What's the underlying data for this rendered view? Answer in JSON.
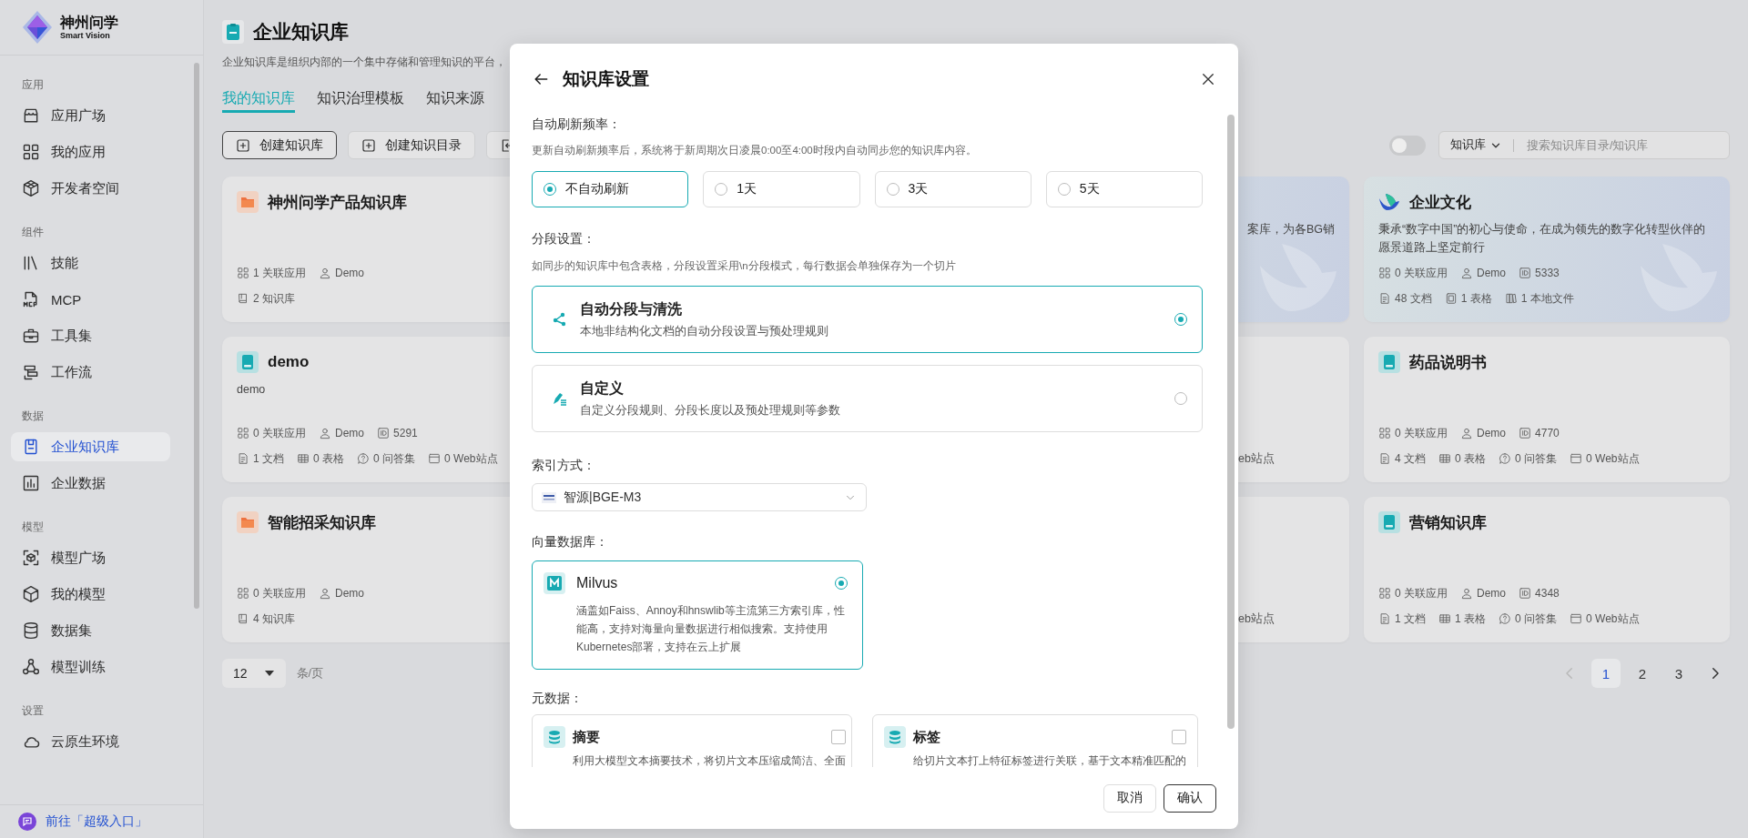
{
  "sidebar": {
    "brand": {
      "name": "神州问学",
      "tagline": "Smart Vision"
    },
    "groups": [
      {
        "label": "应用",
        "items": [
          {
            "label": "应用广场",
            "kind": "store",
            "selected": false
          },
          {
            "label": "我的应用",
            "kind": "apps",
            "selected": false
          },
          {
            "label": "开发者空间",
            "kind": "dev",
            "selected": false
          }
        ]
      },
      {
        "label": "组件",
        "items": [
          {
            "label": "技能",
            "kind": "skill",
            "selected": false
          },
          {
            "label": "MCP",
            "kind": "mcp",
            "selected": false
          },
          {
            "label": "工具集",
            "kind": "tool",
            "selected": false
          },
          {
            "label": "工作流",
            "kind": "flow",
            "selected": false
          }
        ]
      },
      {
        "label": "数据",
        "items": [
          {
            "label": "企业知识库",
            "kind": "doc",
            "selected": true
          },
          {
            "label": "企业数据",
            "kind": "chart",
            "selected": false
          }
        ]
      },
      {
        "label": "模型",
        "items": [
          {
            "label": "模型广场",
            "kind": "scan",
            "selected": false
          },
          {
            "label": "我的模型",
            "kind": "cube",
            "selected": false
          },
          {
            "label": "数据集",
            "kind": "db",
            "selected": false
          },
          {
            "label": "模型训练",
            "kind": "train",
            "selected": false
          }
        ]
      },
      {
        "label": "设置",
        "items": [
          {
            "label": "云原生环境",
            "kind": "cloud",
            "selected": false
          }
        ]
      }
    ],
    "footer_link": "前往「超级入口」"
  },
  "header": {
    "title": "企业知识库",
    "description": "企业知识库是组织内部的一个集中存储和管理知识的平台，"
  },
  "tabs": [
    {
      "label": "我的知识库",
      "selected": true
    },
    {
      "label": "知识治理模板",
      "selected": false
    },
    {
      "label": "知识来源",
      "selected": false
    }
  ],
  "toolbar": {
    "buttons": [
      {
        "label": "创建知识库",
        "kind": "create",
        "emphasized": true
      },
      {
        "label": "创建知识目录",
        "kind": "create",
        "emphasized": false
      },
      {
        "kind": "import",
        "emphasized": false
      }
    ],
    "view_toggle": {
      "on": false
    },
    "search": {
      "scope": "知识库",
      "placeholder": "搜索知识库目录/知识库"
    }
  },
  "card_rows": [
    {
      "cards": [
        {
          "kind": "directory",
          "title": "神州问学产品知识库",
          "featured": false,
          "stats": [
            [
              {
                "kind": "apps",
                "text": "1 关联应用"
              },
              {
                "kind": "user",
                "text": "Demo"
              }
            ],
            [
              {
                "kind": "kbs",
                "text": "2 知识库"
              }
            ]
          ]
        },
        {
          "kind": "fragment",
          "featured": true,
          "description": "案库，为各BG销"
        },
        {
          "kind": "branded",
          "title": "企业文化",
          "featured": true,
          "description": "秉承“数字中国”的初心与使命，在成为领先的数字化转型伙伴的愿景道路上坚定前行",
          "stats": [
            [
              {
                "kind": "apps",
                "text": "0 关联应用"
              },
              {
                "kind": "user",
                "text": "Demo"
              },
              {
                "kind": "id",
                "text": "5333"
              }
            ],
            [
              {
                "kind": "docs",
                "text": "48 文档"
              },
              {
                "kind": "sheet",
                "text": "1 表格"
              },
              {
                "kind": "files",
                "text": "1 本地文件"
              }
            ]
          ]
        }
      ]
    },
    {
      "cards": [
        {
          "kind": "knowledge_base",
          "title": "demo",
          "featured": false,
          "description": "demo",
          "stats": [
            [
              {
                "kind": "apps",
                "text": "0 关联应用"
              },
              {
                "kind": "user",
                "text": "Demo"
              },
              {
                "kind": "id",
                "text": "5291"
              }
            ],
            [
              {
                "kind": "docs",
                "text": "1 文档"
              },
              {
                "kind": "table",
                "text": "0 表格"
              },
              {
                "kind": "qa",
                "text": "0 问答集"
              },
              {
                "kind": "web",
                "text": "0 Web站点"
              }
            ]
          ]
        },
        {
          "kind": "fragment",
          "featured": false,
          "stat": "eb站点"
        },
        {
          "kind": "knowledge_base",
          "title": "药品说明书",
          "featured": false,
          "stats": [
            [
              {
                "kind": "apps",
                "text": "0 关联应用"
              },
              {
                "kind": "user",
                "text": "Demo"
              },
              {
                "kind": "id",
                "text": "4770"
              }
            ],
            [
              {
                "kind": "docs",
                "text": "4 文档"
              },
              {
                "kind": "table",
                "text": "0 表格"
              },
              {
                "kind": "qa",
                "text": "0 问答集"
              },
              {
                "kind": "web",
                "text": "0 Web站点"
              }
            ]
          ]
        }
      ]
    },
    {
      "cards": [
        {
          "kind": "directory",
          "title": "智能招采知识库",
          "featured": false,
          "stats": [
            [
              {
                "kind": "apps",
                "text": "0 关联应用"
              },
              {
                "kind": "user",
                "text": "Demo"
              }
            ],
            [
              {
                "kind": "kbs",
                "text": "4 知识库"
              }
            ]
          ]
        },
        {
          "kind": "fragment",
          "featured": false,
          "stat": "eb站点"
        },
        {
          "kind": "knowledge_base",
          "title": "营销知识库",
          "featured": false,
          "stats": [
            [
              {
                "kind": "apps",
                "text": "0 关联应用"
              },
              {
                "kind": "user",
                "text": "Demo"
              },
              {
                "kind": "id",
                "text": "4348"
              }
            ],
            [
              {
                "kind": "docs",
                "text": "1 文档"
              },
              {
                "kind": "table",
                "text": "1 表格"
              },
              {
                "kind": "qa",
                "text": "0 问答集"
              },
              {
                "kind": "web",
                "text": "0 Web站点"
              }
            ]
          ]
        }
      ]
    }
  ],
  "pagination": {
    "page_size": "12",
    "page_size_unit": "条/页",
    "prev_disabled": true,
    "next_disabled": false,
    "pages": [
      {
        "label": "1",
        "selected": true
      },
      {
        "label": "2",
        "selected": false
      },
      {
        "label": "3",
        "selected": false
      }
    ]
  },
  "modal": {
    "title": "知识库设置",
    "refresh": {
      "label": "自动刷新频率：",
      "hint": "更新自动刷新频率后，系统将于新周期次日凌晨0:00至4:00时段内自动同步您的知识库内容。",
      "options": [
        {
          "label": "不自动刷新",
          "selected": true
        },
        {
          "label": "1天",
          "selected": false
        },
        {
          "label": "3天",
          "selected": false
        },
        {
          "label": "5天",
          "selected": false
        }
      ]
    },
    "segmentation": {
      "label": "分段设置：",
      "hint": "如同步的知识库中包含表格，分段设置采用\\n分段模式，每行数据会单独保存为一个切片",
      "options": [
        {
          "kind": "auto",
          "title": "自动分段与清洗",
          "description": "本地非结构化文档的自动分段设置与预处理规则",
          "selected": true
        },
        {
          "kind": "custom",
          "title": "自定义",
          "description": "自定义分段规则、分段长度以及预处理规则等参数",
          "selected": false
        }
      ]
    },
    "index": {
      "label": "索引方式：",
      "value": "智源|BGE-M3"
    },
    "vector_db": {
      "label": "向量数据库：",
      "options": [
        {
          "name": "Milvus",
          "description": "涵盖如Faiss、Annoy和hnswlib等主流第三方索引库，性能高，支持对海量向量数据进行相似搜索。支持使用Kubernetes部署，支持在云上扩展",
          "selected": true
        }
      ]
    },
    "metadata": {
      "label": "元数据：",
      "options": [
        {
          "title": "摘要",
          "description": "利用大模型文本摘要技术，将切片文本压缩成简洁、全面",
          "checked": false
        },
        {
          "title": "标签",
          "description": "给切片文本打上特征标签进行关联，基于文本精准匹配的",
          "checked": false
        }
      ]
    },
    "buttons": [
      {
        "label": "取消",
        "primary": false
      },
      {
        "label": "确认",
        "primary": true
      }
    ]
  }
}
